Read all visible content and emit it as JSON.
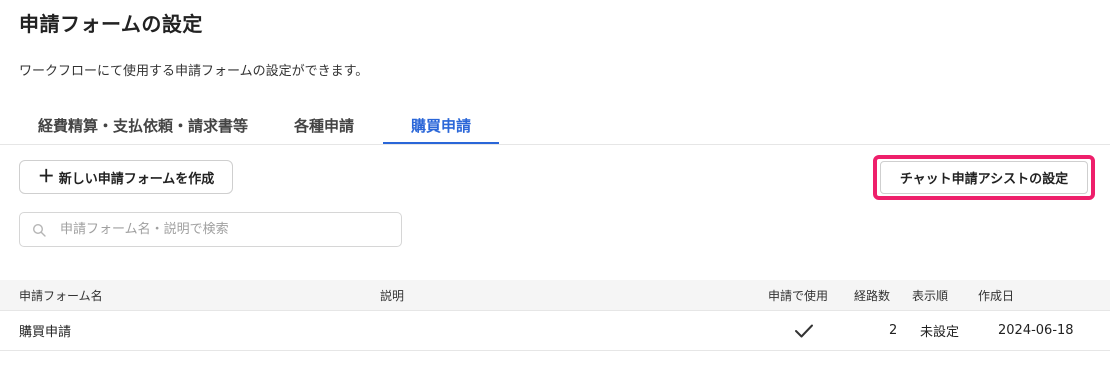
{
  "page": {
    "title": "申請フォームの設定",
    "description": "ワークフローにて使用する申請フォームの設定ができます。"
  },
  "tabs": [
    {
      "label": "経費精算・支払依頼・請求書等",
      "active": false
    },
    {
      "label": "各種申請",
      "active": false
    },
    {
      "label": "購買申請",
      "active": true
    }
  ],
  "toolbar": {
    "create_plus": "＋",
    "create_label": "新しい申請フォームを作成",
    "chat_assist_label": "チャット申請アシストの設定"
  },
  "search": {
    "placeholder": "申請フォーム名・説明で検索",
    "value": "",
    "icon": "search-icon"
  },
  "table": {
    "headers": {
      "name": "申請フォーム名",
      "description": "説明",
      "used": "申請で使用",
      "routes": "経路数",
      "order": "表示順",
      "created": "作成日"
    },
    "rows": [
      {
        "name": "購買申請",
        "description": "",
        "used_icon": "check-icon",
        "routes": "2",
        "order": "未設定",
        "created": "2024-06-18"
      }
    ]
  },
  "colors": {
    "accent": "#2a66d8",
    "highlight": "#ee1f6b"
  }
}
